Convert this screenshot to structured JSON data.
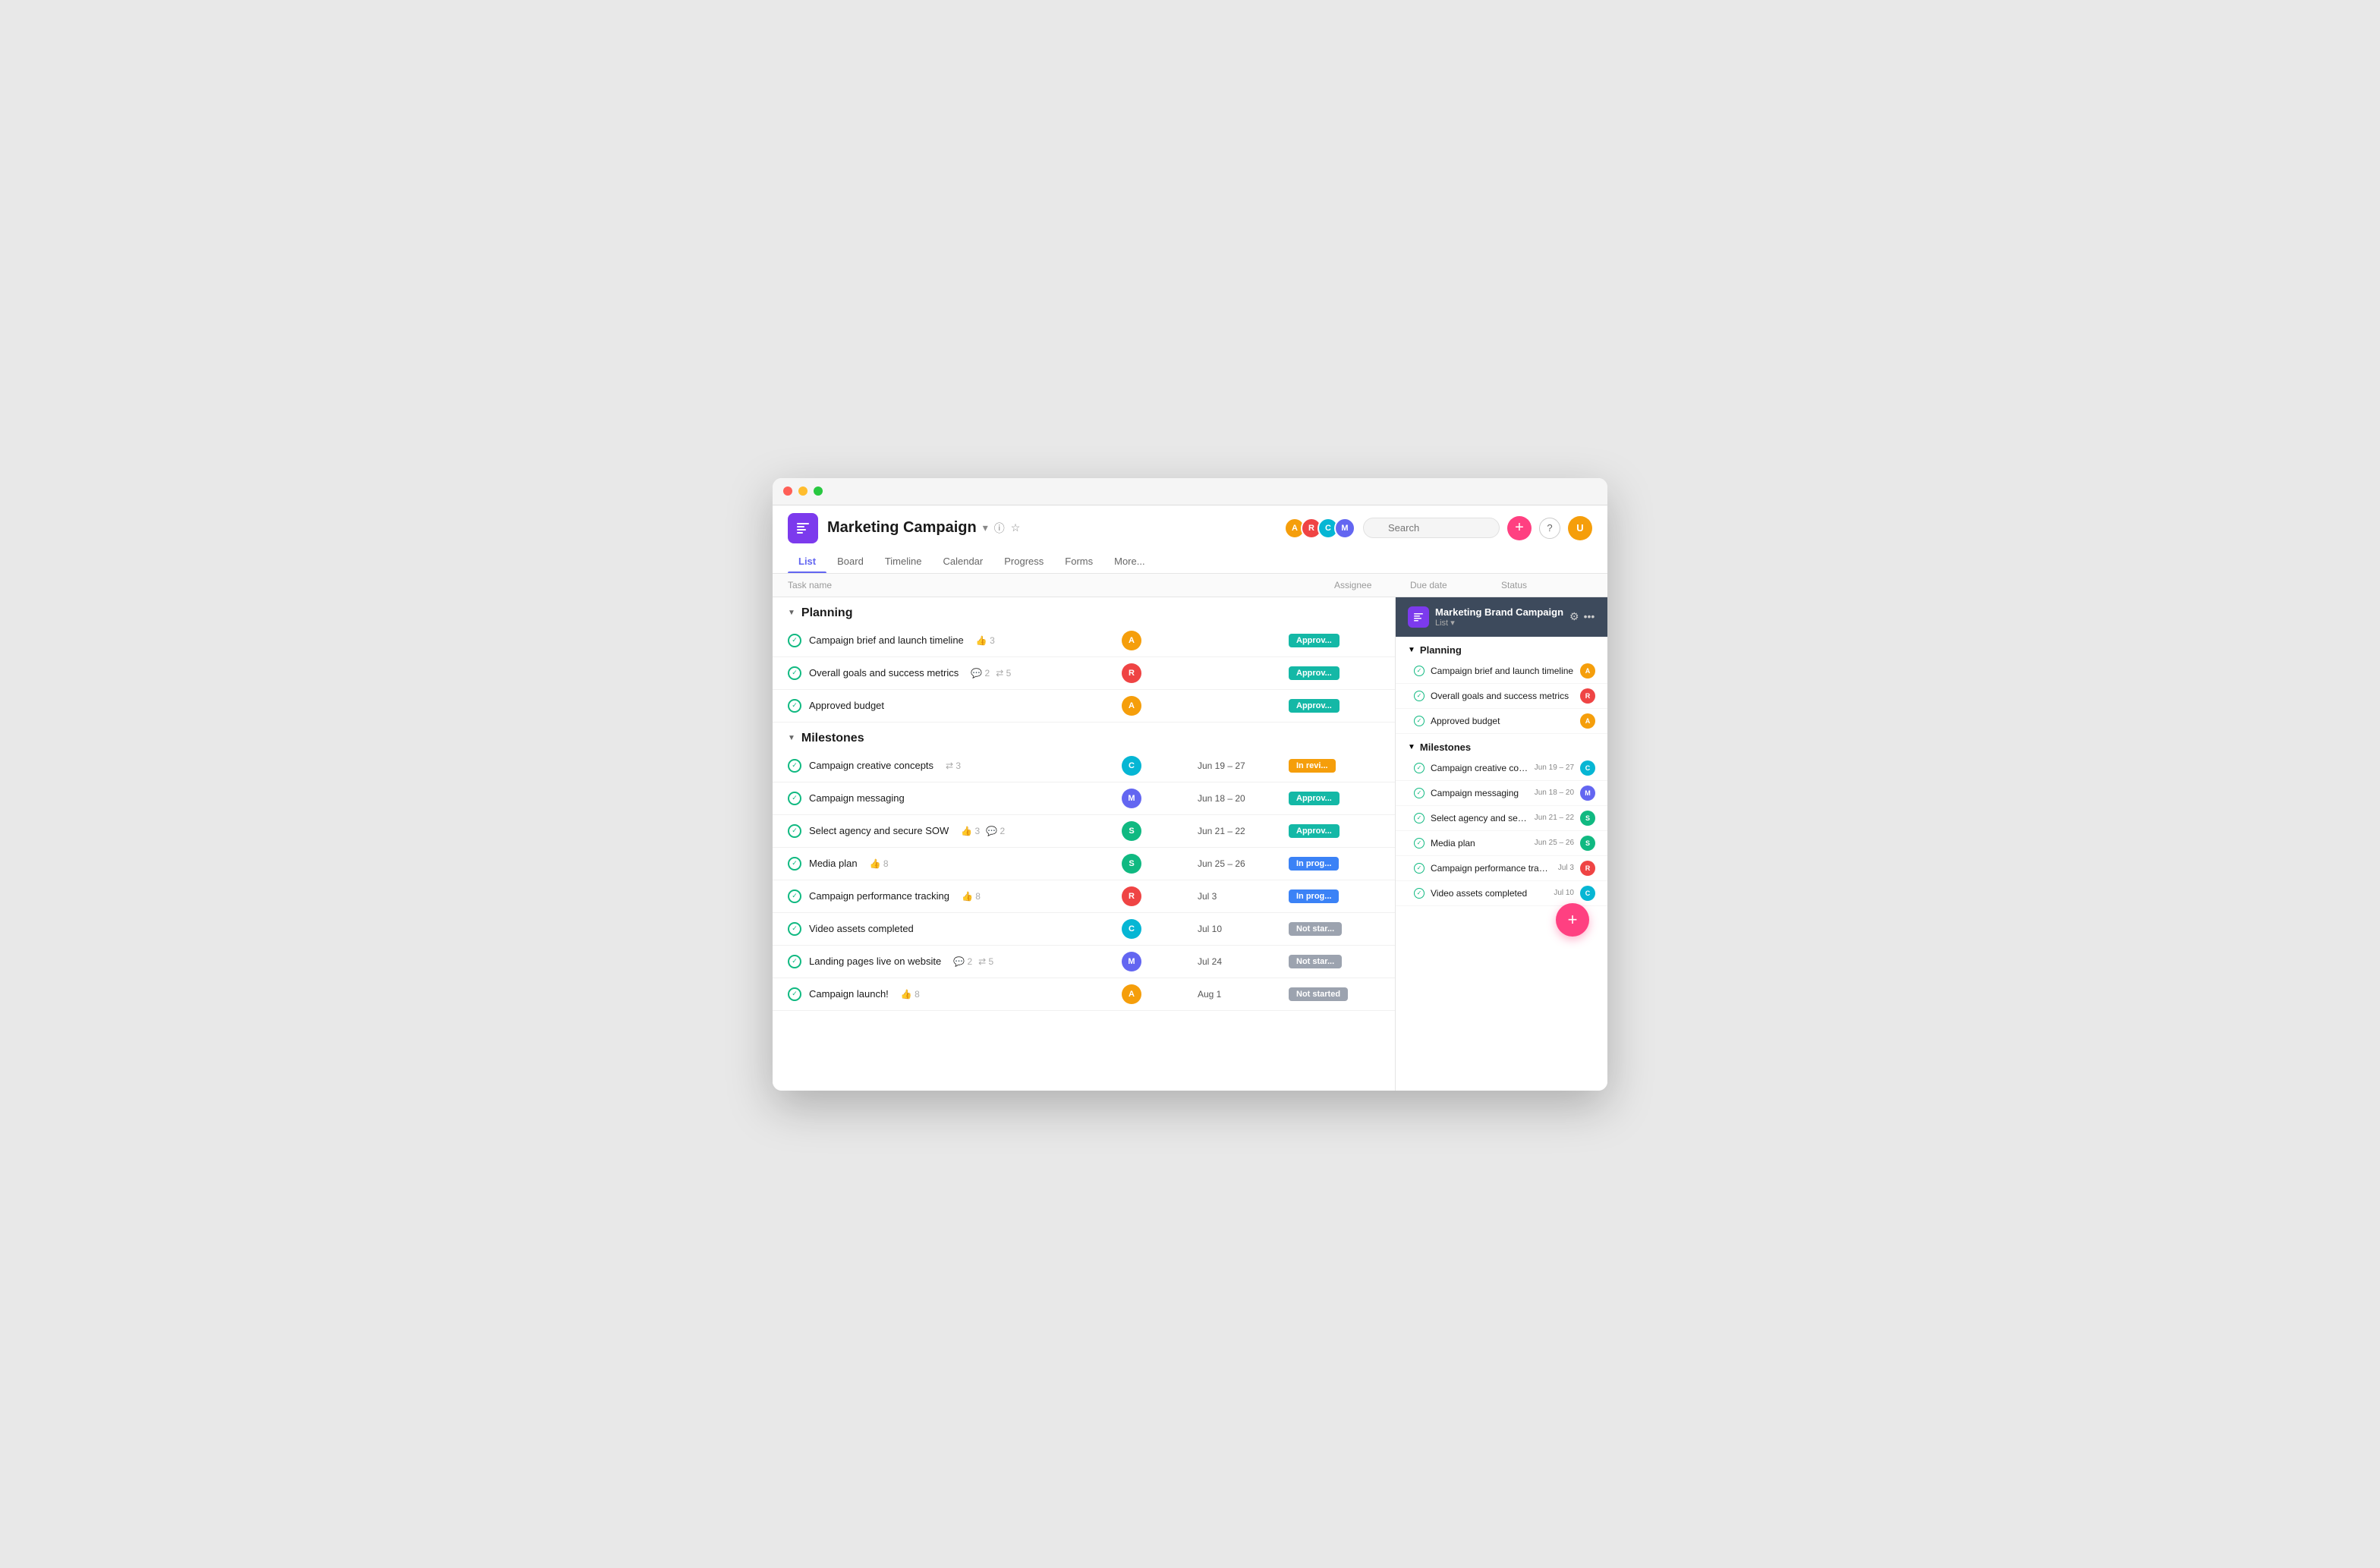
{
  "window": {
    "title": "Marketing Campaign"
  },
  "header": {
    "project_name": "Marketing Campaign",
    "nav_tabs": [
      {
        "label": "List",
        "active": true
      },
      {
        "label": "Board",
        "active": false
      },
      {
        "label": "Timeline",
        "active": false
      },
      {
        "label": "Calendar",
        "active": false
      },
      {
        "label": "Progress",
        "active": false
      },
      {
        "label": "Forms",
        "active": false
      },
      {
        "label": "More...",
        "active": false
      }
    ],
    "search_placeholder": "Search"
  },
  "table": {
    "columns": [
      "Task name",
      "Assignee",
      "Due date",
      "Status"
    ]
  },
  "sections": [
    {
      "name": "Planning",
      "tasks": [
        {
          "name": "Campaign brief and launch timeline",
          "meta": {
            "likes": 3
          },
          "assignee_color": "#f59e0b",
          "assignee_initials": "A",
          "due_date": "",
          "status": "Approved",
          "status_class": "status-approved"
        },
        {
          "name": "Overall goals and success metrics",
          "meta": {
            "comments": 2,
            "subtasks": 5
          },
          "assignee_color": "#ef4444",
          "assignee_initials": "R",
          "due_date": "",
          "status": "Approved",
          "status_class": "status-approved"
        },
        {
          "name": "Approved budget",
          "meta": {},
          "assignee_color": "#f59e0b",
          "assignee_initials": "A",
          "due_date": "",
          "status": "Approved",
          "status_class": "status-approved"
        }
      ]
    },
    {
      "name": "Milestones",
      "tasks": [
        {
          "name": "Campaign creative concepts",
          "meta": {
            "subtasks": 3
          },
          "assignee_color": "#06b6d4",
          "assignee_initials": "C",
          "due_date": "Jun 19 – 27",
          "status": "In review",
          "status_class": "status-in-review"
        },
        {
          "name": "Campaign messaging",
          "meta": {},
          "assignee_color": "#6366f1",
          "assignee_initials": "M",
          "due_date": "Jun 18 – 20",
          "status": "Approved",
          "status_class": "status-approved"
        },
        {
          "name": "Select agency and secure SOW",
          "meta": {
            "likes": 3,
            "comments": 2
          },
          "assignee_color": "#10b981",
          "assignee_initials": "S",
          "due_date": "Jun 21 – 22",
          "status": "Approved",
          "status_class": "status-approved"
        },
        {
          "name": "Media plan",
          "meta": {
            "likes": 8
          },
          "assignee_color": "#10b981",
          "assignee_initials": "S",
          "due_date": "Jun 25 – 26",
          "status": "In progress",
          "status_class": "status-in-progress"
        },
        {
          "name": "Campaign performance tracking",
          "meta": {
            "likes": 8
          },
          "assignee_color": "#ef4444",
          "assignee_initials": "R",
          "due_date": "Jul 3",
          "status": "In progress",
          "status_class": "status-in-progress"
        },
        {
          "name": "Video assets completed",
          "meta": {},
          "assignee_color": "#06b6d4",
          "assignee_initials": "C",
          "due_date": "Jul 10",
          "status": "Not started",
          "status_class": "status-not-started"
        },
        {
          "name": "Landing pages live on website",
          "meta": {
            "comments": 2,
            "subtasks": 5
          },
          "assignee_color": "#6366f1",
          "assignee_initials": "M",
          "due_date": "Jul 24",
          "status": "Not started",
          "status_class": "status-not-started"
        },
        {
          "name": "Campaign launch!",
          "meta": {
            "likes": 8
          },
          "assignee_color": "#f59e0b",
          "assignee_initials": "A",
          "due_date": "Aug 1",
          "status": "Not started",
          "status_class": "status-not-started"
        }
      ]
    }
  ],
  "side_panel": {
    "title": "Marketing Brand Campaign",
    "subtitle": "List",
    "icon_label": "list-icon",
    "sections": [
      {
        "name": "Planning",
        "tasks": [
          {
            "name": "Campaign brief and launch timeline",
            "date": "",
            "avatar_color": "#f59e0b",
            "avatar_initials": "A"
          },
          {
            "name": "Overall goals and success metrics",
            "date": "",
            "avatar_color": "#ef4444",
            "avatar_initials": "R"
          },
          {
            "name": "Approved budget",
            "date": "",
            "avatar_color": "#f59e0b",
            "avatar_initials": "A"
          }
        ]
      },
      {
        "name": "Milestones",
        "tasks": [
          {
            "name": "Campaign creative conc...",
            "date": "Jun 19 – 27",
            "avatar_color": "#06b6d4",
            "avatar_initials": "C"
          },
          {
            "name": "Campaign messaging",
            "date": "Jun 18 – 20",
            "avatar_color": "#6366f1",
            "avatar_initials": "M"
          },
          {
            "name": "Select agency and secu...",
            "date": "Jun 21 – 22",
            "avatar_color": "#10b981",
            "avatar_initials": "S"
          },
          {
            "name": "Media plan",
            "date": "Jun 25 – 26",
            "avatar_color": "#10b981",
            "avatar_initials": "S"
          },
          {
            "name": "Campaign performance track...",
            "date": "Jul 3",
            "avatar_color": "#ef4444",
            "avatar_initials": "R"
          },
          {
            "name": "Video assets completed",
            "date": "Jul 10",
            "avatar_color": "#06b6d4",
            "avatar_initials": "C"
          }
        ]
      }
    ]
  },
  "avatars": [
    {
      "color": "#f59e0b",
      "initials": "A"
    },
    {
      "color": "#ef4444",
      "initials": "R"
    },
    {
      "color": "#06b6d4",
      "initials": "C"
    },
    {
      "color": "#6366f1",
      "initials": "M"
    }
  ],
  "labels": {
    "add_button": "+",
    "help_button": "?",
    "fab_button": "+"
  }
}
